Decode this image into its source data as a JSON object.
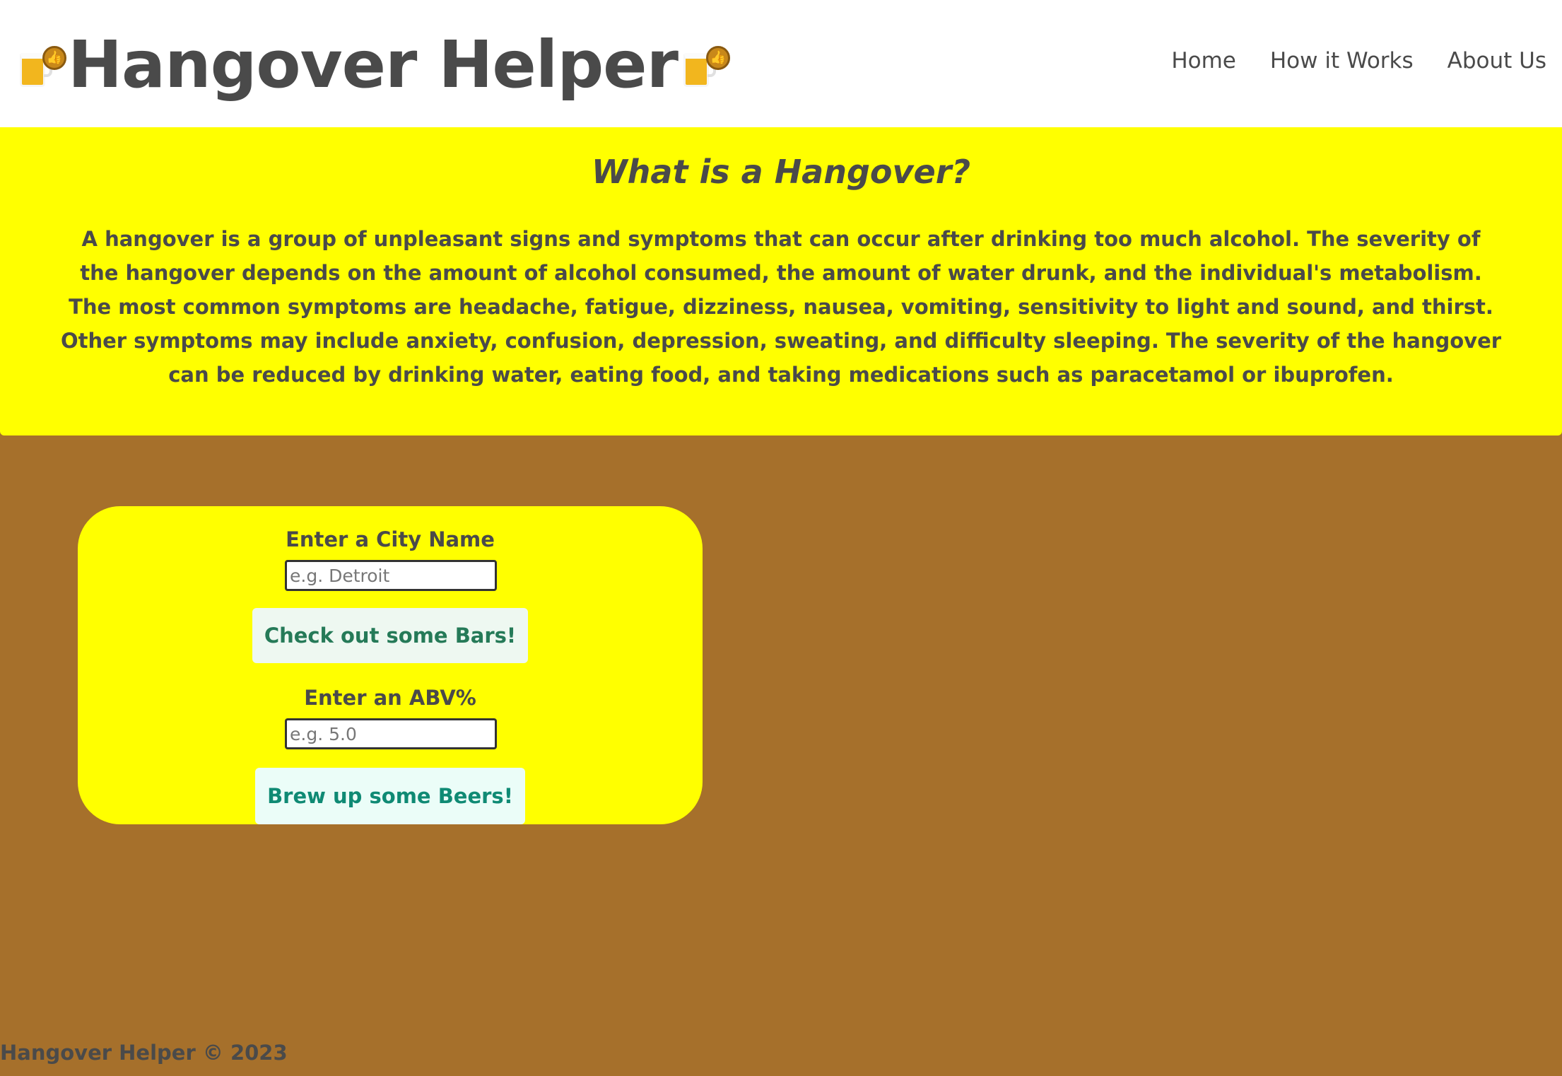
{
  "header": {
    "title": "Hangover Helper",
    "nav": [
      {
        "label": "Home"
      },
      {
        "label": "How it Works"
      },
      {
        "label": "About Us"
      }
    ],
    "icons": [
      "beer-mug-thumbs-up-icon",
      "beer-mug-thumbs-up-icon"
    ]
  },
  "hero": {
    "title": "What is a Hangover?",
    "text": "A hangover is a group of unpleasant signs and symptoms that can occur after drinking too much alcohol. The severity of the hangover depends on the amount of alcohol consumed, the amount of water drunk, and the individual's metabolism. The most common symptoms are headache, fatigue, dizziness, nausea, vomiting, sensitivity to light and sound, and thirst. Other symptoms may include anxiety, confusion, depression, sweating, and difficulty sleeping. The severity of the hangover can be reduced by drinking water, eating food, and taking medications such as paracetamol or ibuprofen."
  },
  "form": {
    "city_label": "Enter a City Name",
    "city_placeholder": "e.g. Detroit",
    "city_value": "",
    "bars_button": "Check out some Bars!",
    "abv_label": "Enter an ABV%",
    "abv_placeholder": "e.g. 5.0",
    "abv_value": "",
    "beers_button": "Brew up some Beers!"
  },
  "footer": {
    "text": "Hangover Helper © 2023"
  },
  "colors": {
    "background": "#a6702b",
    "accent_yellow": "#ffff00",
    "text": "#4a4a4a",
    "bars_button_text": "#257a58",
    "beers_button_text": "#0f8a74"
  }
}
